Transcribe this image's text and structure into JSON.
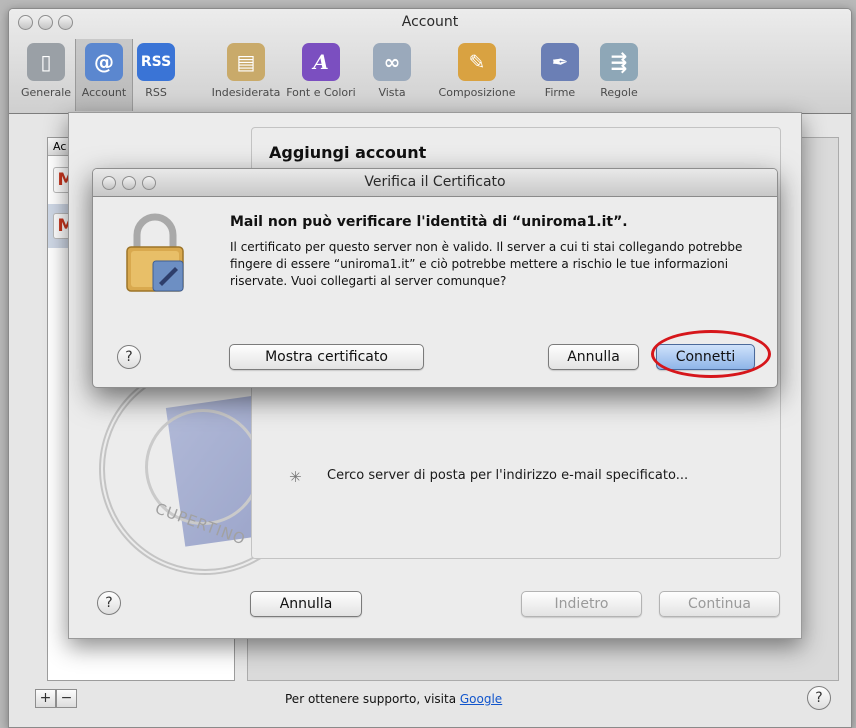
{
  "window": {
    "title": "Account"
  },
  "toolbar": {
    "items": [
      {
        "label": "Generale",
        "icon": "gear-switch-icon",
        "color": "#9aa0a6"
      },
      {
        "label": "Account",
        "icon": "at-sign-icon",
        "color": "#3a6fc4"
      },
      {
        "label": "RSS",
        "icon": "rss-icon",
        "color": "#3a74d6"
      },
      {
        "label": "Indesiderata",
        "icon": "trash-icon",
        "color": "#b99a5c"
      },
      {
        "label": "Font e Colori",
        "icon": "font-icon",
        "color": "#6c3fb0"
      },
      {
        "label": "Vista",
        "icon": "glasses-icon",
        "color": "#8a9bb0"
      },
      {
        "label": "Composizione",
        "icon": "pencil-icon",
        "color": "#d9a241"
      },
      {
        "label": "Firme",
        "icon": "pen-icon",
        "color": "#5a6fa8"
      },
      {
        "label": "Regole",
        "icon": "rules-icon",
        "color": "#7f98a8"
      }
    ]
  },
  "accounts": {
    "header": "Ac",
    "icon_text": "M"
  },
  "sheet": {
    "title": "Aggiungi account",
    "status": "Cerco server di posta per l'indirizzo e-mail specificato...",
    "stamp_text": "CUPERTINO",
    "cancel_label": "Annulla",
    "back_label": "Indietro",
    "continue_label": "Continua"
  },
  "cert_dialog": {
    "title": "Verifica il Certificato",
    "heading": "Mail non può verificare l'identità di “uniroma1.it”.",
    "body": "Il certificato per questo server non è valido. Il server a cui ti stai collegando potrebbe fingere di essere “uniroma1.it” e ciò potrebbe mettere a rischio le tue informazioni riservate. Vuoi collegarti al server comunque?",
    "show_cert_label": "Mostra certificato",
    "cancel_label": "Annulla",
    "connect_label": "Connetti",
    "help_label": "?"
  },
  "footer": {
    "support_text": "Per ottenere supporto, visita ",
    "support_link": "Google",
    "add_label": "+",
    "remove_label": "−",
    "help_label": "?"
  },
  "colors": {
    "highlight_ring": "#d6161b",
    "default_button": "#8fb5e8"
  }
}
